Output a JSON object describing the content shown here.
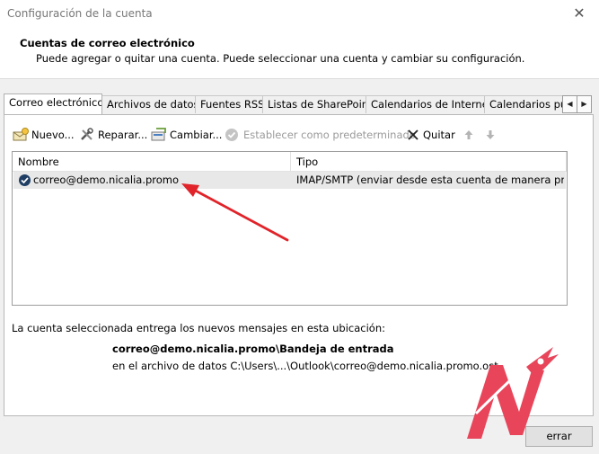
{
  "window": {
    "title": "Configuración de la cuenta"
  },
  "header": {
    "title": "Cuentas de correo electrónico",
    "description": "Puede agregar o quitar una cuenta. Puede seleccionar una cuenta y cambiar su configuración."
  },
  "tabs": [
    {
      "label": "Correo electrónico",
      "active": true
    },
    {
      "label": "Archivos de datos"
    },
    {
      "label": "Fuentes RSS"
    },
    {
      "label": "Listas de SharePoint"
    },
    {
      "label": "Calendarios de Internet"
    },
    {
      "label": "Calendarios pu"
    }
  ],
  "toolbar": {
    "new_label": "Nuevo...",
    "repair_label": "Reparar...",
    "change_label": "Cambiar...",
    "set_default_label": "Establecer como predeterminado",
    "remove_label": "Quitar"
  },
  "list": {
    "columns": [
      "Nombre",
      "Tipo"
    ],
    "rows": [
      {
        "name": "correo@demo.nicalia.promo",
        "type": "IMAP/SMTP (enviar desde esta cuenta de manera predet..."
      }
    ]
  },
  "delivery": {
    "info": "La cuenta seleccionada entrega los nuevos mensajes en esta ubicación:",
    "location": "correo@demo.nicalia.promo\\Bandeja de entrada",
    "data_file": "en el archivo de datos C:\\Users\\...\\Outlook\\correo@demo.nicalia.promo.ost"
  },
  "footer": {
    "close_label": "errar"
  },
  "colors": {
    "arrow": "#e0242a",
    "logo": "#e8455a",
    "selected_row": "#e8e8e8"
  }
}
